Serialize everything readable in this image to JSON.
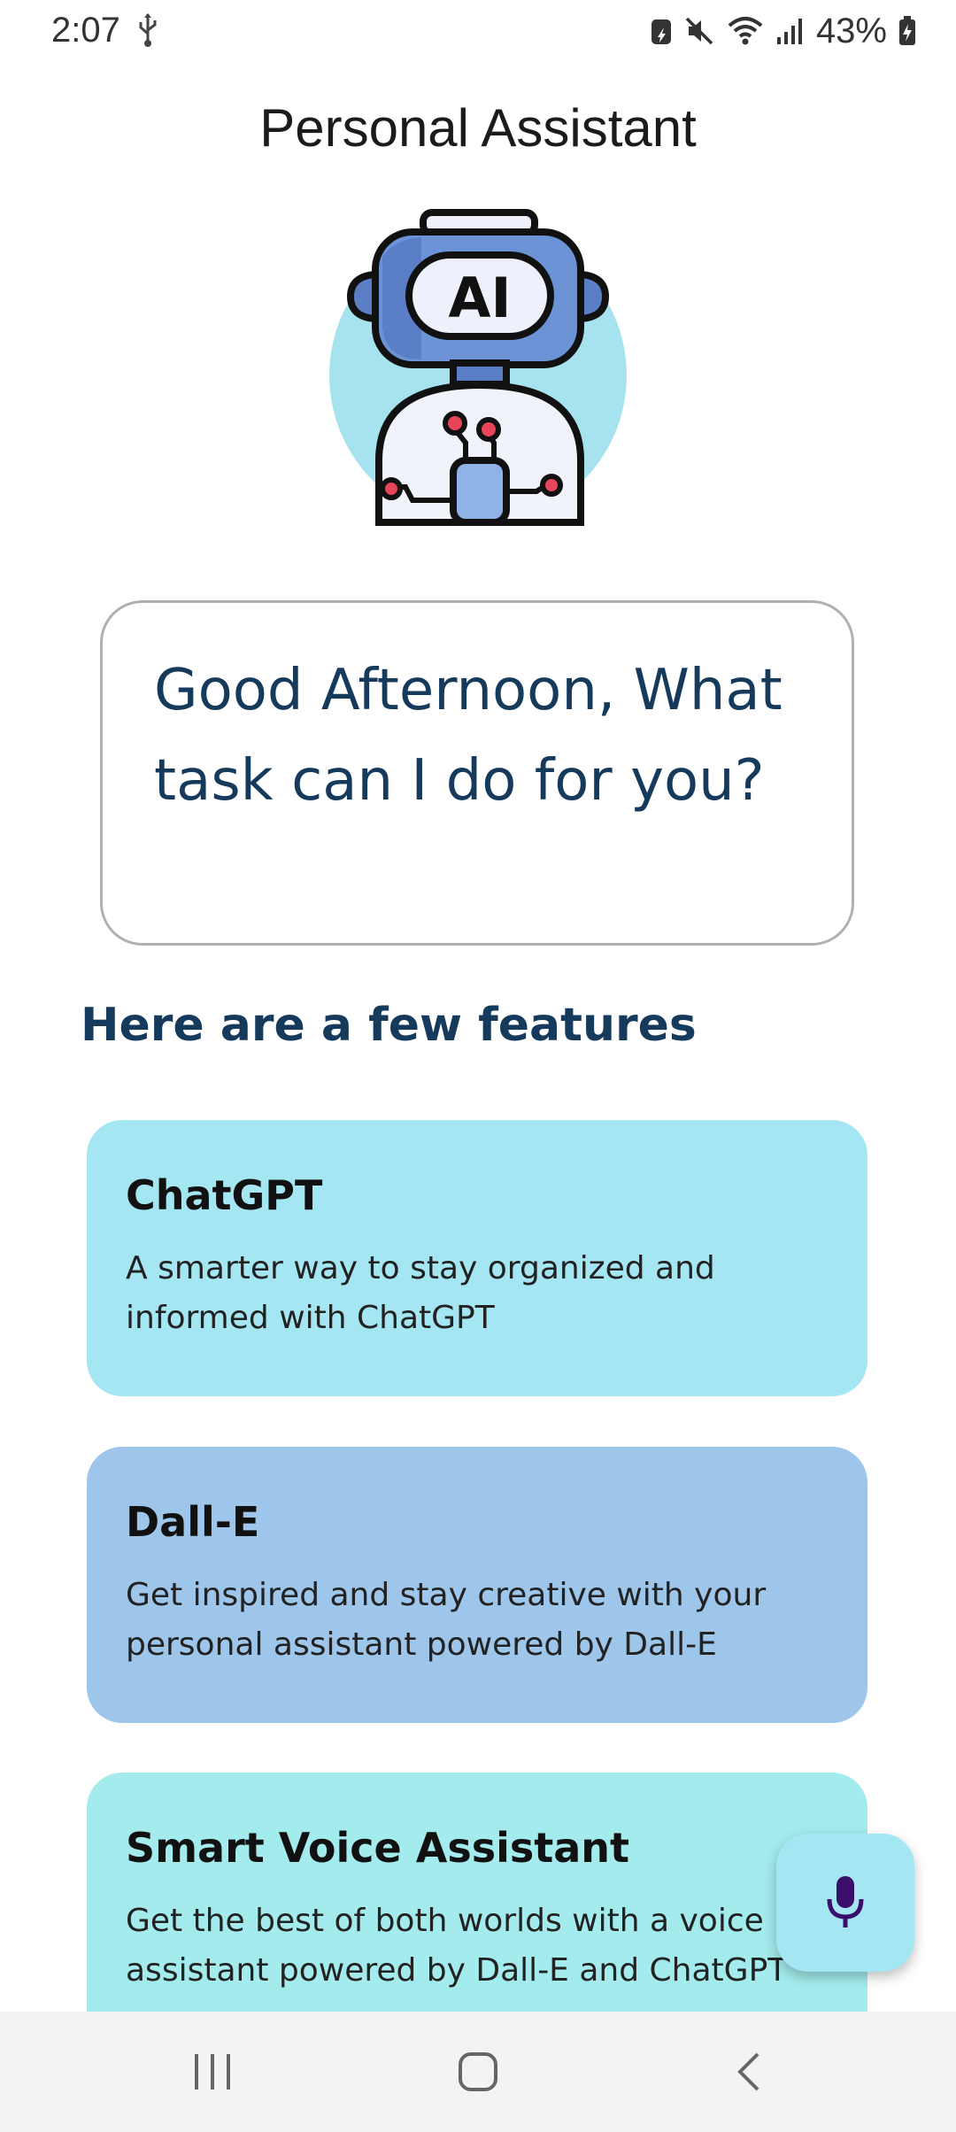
{
  "status_bar": {
    "time": "2:07",
    "battery": "43%"
  },
  "app": {
    "title": "Personal Assistant",
    "avatar_icon": "robot-ai-icon",
    "avatar_label": "AI"
  },
  "greeting": {
    "text": "Good Afternoon, What task can I do for you?"
  },
  "features": {
    "heading": "Here are a few features",
    "items": [
      {
        "title": "ChatGPT",
        "description": "A smarter way to stay organized and informed with ChatGPT",
        "color": "#a5e6f3"
      },
      {
        "title": "Dall-E",
        "description": "Get inspired and stay creative with your personal assistant powered by Dall-E",
        "color": "#9dc6ea"
      },
      {
        "title": "Smart Voice Assistant",
        "description": "Get the best of both worlds with a voice assistant powered by Dall-E and ChatGPT",
        "color": "#a3ebec"
      }
    ]
  },
  "mic_button": {
    "icon": "microphone-icon",
    "color": "#a5e6f3",
    "icon_color": "#3a0f6b"
  },
  "colors": {
    "heading_text": "#163a5b",
    "nav_bar": "#f3f3f5"
  }
}
